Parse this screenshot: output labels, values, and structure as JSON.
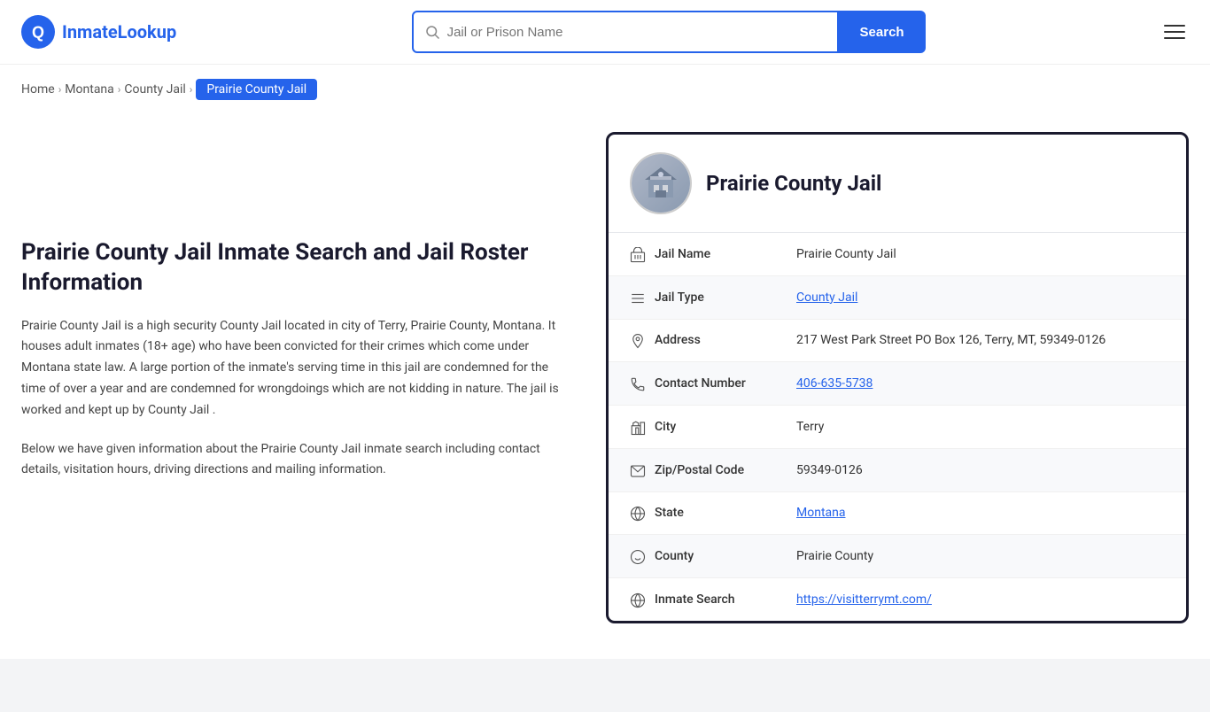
{
  "header": {
    "logo_text_part1": "Inmate",
    "logo_text_part2": "Lookup",
    "search_placeholder": "Jail or Prison Name",
    "search_button_label": "Search"
  },
  "breadcrumb": {
    "home": "Home",
    "state": "Montana",
    "type": "County Jail",
    "current": "Prairie County Jail"
  },
  "left": {
    "title": "Prairie County Jail Inmate Search and Jail Roster Information",
    "description1": "Prairie County Jail is a high security County Jail located in city of Terry, Prairie County, Montana. It houses adult inmates (18+ age) who have been convicted for their crimes which come under Montana state law. A large portion of the inmate's serving time in this jail are condemned for the time of over a year and are condemned for wrongdoings which are not kidding in nature. The jail is worked and kept up by County Jail .",
    "description2": "Below we have given information about the Prairie County Jail inmate search including contact details, visitation hours, driving directions and mailing information."
  },
  "card": {
    "jail_name_header": "Prairie County Jail",
    "rows": [
      {
        "icon": "jail-icon",
        "label": "Jail Name",
        "value": "Prairie County Jail",
        "link": null
      },
      {
        "icon": "list-icon",
        "label": "Jail Type",
        "value": "County Jail",
        "link": "#"
      },
      {
        "icon": "location-icon",
        "label": "Address",
        "value": "217 West Park Street PO Box 126, Terry, MT, 59349-0126",
        "link": null
      },
      {
        "icon": "phone-icon",
        "label": "Contact Number",
        "value": "406-635-5738",
        "link": "tel:406-635-5738"
      },
      {
        "icon": "city-icon",
        "label": "City",
        "value": "Terry",
        "link": null
      },
      {
        "icon": "mail-icon",
        "label": "Zip/Postal Code",
        "value": "59349-0126",
        "link": null
      },
      {
        "icon": "globe-icon",
        "label": "State",
        "value": "Montana",
        "link": "#"
      },
      {
        "icon": "county-icon",
        "label": "County",
        "value": "Prairie County",
        "link": null
      },
      {
        "icon": "web-icon",
        "label": "Inmate Search",
        "value": "https://visitterrymt.com/",
        "link": "https://visitterrymt.com/"
      }
    ]
  }
}
